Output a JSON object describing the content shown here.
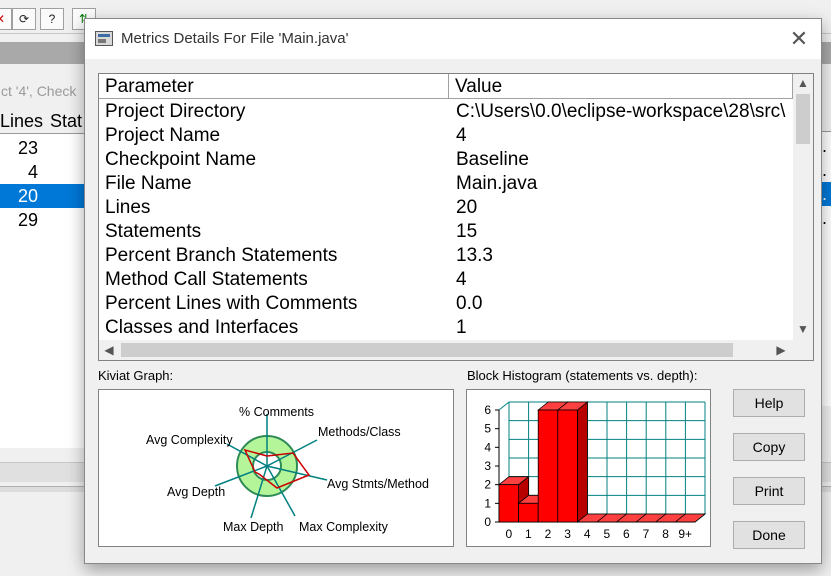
{
  "background": {
    "status_text": "ct '4', Check",
    "table_headers": [
      "Lines",
      "Stat"
    ],
    "rows": [
      {
        "lines": "23",
        "selected": false
      },
      {
        "lines": "4",
        "selected": false
      },
      {
        "lines": "20",
        "selected": true
      },
      {
        "lines": "29",
        "selected": false
      }
    ],
    "right_header": "h",
    "right_cells": [
      "1.",
      "1.",
      "2.",
      "1."
    ]
  },
  "dialog": {
    "title": "Metrics Details For File 'Main.java'",
    "close_glyph": "✕",
    "columns": {
      "parameter": "Parameter",
      "value": "Value"
    },
    "rows": [
      {
        "parameter": "Project Directory",
        "value": "C:\\Users\\0.0\\eclipse-workspace\\28\\src\\"
      },
      {
        "parameter": "Project Name",
        "value": "4"
      },
      {
        "parameter": "Checkpoint Name",
        "value": "Baseline"
      },
      {
        "parameter": "File Name",
        "value": "Main.java"
      },
      {
        "parameter": "Lines",
        "value": "20"
      },
      {
        "parameter": "Statements",
        "value": "15"
      },
      {
        "parameter": "Percent Branch Statements",
        "value": "13.3"
      },
      {
        "parameter": "Method Call Statements",
        "value": "4"
      },
      {
        "parameter": "Percent Lines with Comments",
        "value": "0.0"
      },
      {
        "parameter": "Classes and Interfaces",
        "value": "1"
      }
    ],
    "kiviat_label": "Kiviat Graph:",
    "histogram_label": "Block Histogram (statements vs. depth):",
    "buttons": {
      "help": "Help",
      "copy": "Copy",
      "print": "Print",
      "done": "Done"
    }
  },
  "chart_data": [
    {
      "type": "radar",
      "title": "Kiviat Graph:",
      "axes": [
        "% Comments",
        "Methods/Class",
        "Avg Stmts/Method",
        "Max Complexity",
        "Max Depth",
        "Avg Depth",
        "Avg Complexity"
      ],
      "colors": {
        "band": "#b5f59a",
        "ring": "#2e8b57",
        "polygon": "#cc0000",
        "spoke": "#008080"
      }
    },
    {
      "type": "bar",
      "title": "Block Histogram (statements vs. depth):",
      "categories": [
        "0",
        "1",
        "2",
        "3",
        "4",
        "5",
        "6",
        "7",
        "8",
        "9+"
      ],
      "values": [
        2,
        1,
        6,
        6,
        0,
        0,
        0,
        0,
        0,
        0
      ],
      "ylim": [
        0,
        6
      ],
      "yticks": [
        "0",
        "1",
        "2",
        "3",
        "4",
        "5",
        "6"
      ],
      "colors": {
        "bar": "#ff0000",
        "grid": "#008080"
      }
    }
  ]
}
